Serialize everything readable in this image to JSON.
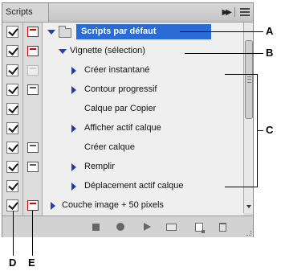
{
  "panel": {
    "tab_label": "Scripts"
  },
  "rows": [
    {
      "label": "Scripts par défaut",
      "dialog": "red"
    },
    {
      "label": "Vignette (sélection)",
      "dialog": "red"
    },
    {
      "label": "Créer instantané",
      "dialog": "faint"
    },
    {
      "label": "Contour progressif",
      "dialog": "normal"
    },
    {
      "label": "Calque par Copier",
      "dialog": "none"
    },
    {
      "label": "Afficher actif calque",
      "dialog": "none"
    },
    {
      "label": "Créer calque",
      "dialog": "normal"
    },
    {
      "label": "Remplir",
      "dialog": "normal"
    },
    {
      "label": "Déplacement actif calque",
      "dialog": "none"
    },
    {
      "label": "Couche image + 50 pixels",
      "dialog": "red"
    }
  ],
  "callouts": {
    "a": "A",
    "b": "B",
    "c": "C",
    "d": "D",
    "e": "E"
  },
  "colors": {
    "highlight": "#2a6bd6",
    "triangle": "#1d3fb8",
    "dialog_red": "#d40000"
  },
  "icons": [
    "forward-icon",
    "panel-menu-icon",
    "check-icon",
    "dialog-toggle-icon",
    "expand-triangle-icon",
    "folder-icon",
    "stop-icon",
    "record-icon",
    "play-icon",
    "new-set-icon",
    "new-action-icon",
    "trash-icon"
  ]
}
